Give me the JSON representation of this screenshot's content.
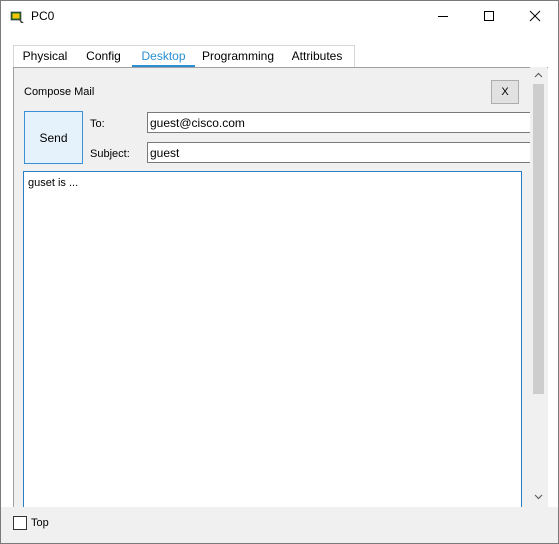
{
  "window": {
    "title": "PC0"
  },
  "tabs": [
    {
      "label": "Physical",
      "active": false
    },
    {
      "label": "Config",
      "active": false
    },
    {
      "label": "Desktop",
      "active": true
    },
    {
      "label": "Programming",
      "active": false
    },
    {
      "label": "Attributes",
      "active": false
    }
  ],
  "compose": {
    "heading": "Compose Mail",
    "close_label": "X",
    "send_label": "Send",
    "to_label": "To:",
    "to_value": "guest@cisco.com",
    "subject_label": "Subject:",
    "subject_value": "guest",
    "body_text": "guset is ..."
  },
  "footer": {
    "top_label": "Top",
    "top_checked": false
  },
  "colors": {
    "accent": "#2a8fd4",
    "send_bg": "#e5f1fb"
  }
}
